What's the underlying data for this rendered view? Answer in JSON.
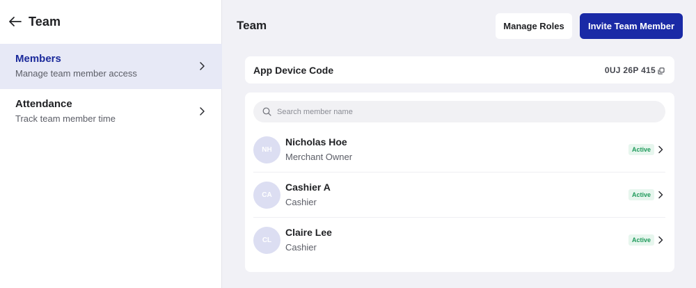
{
  "sidebar": {
    "title": "Team",
    "items": [
      {
        "title": "Members",
        "subtitle": "Manage team member access"
      },
      {
        "title": "Attendance",
        "subtitle": "Track team member time"
      }
    ]
  },
  "main": {
    "title": "Team",
    "manage_roles_label": "Manage Roles",
    "invite_label": "Invite Team Member"
  },
  "device_code": {
    "label": "App Device Code",
    "value": "0UJ 26P 415"
  },
  "search": {
    "placeholder": "Search member name"
  },
  "members": [
    {
      "initials": "NH",
      "name": "Nicholas Hoe",
      "role": "Merchant Owner",
      "status": "Active"
    },
    {
      "initials": "CA",
      "name": "Cashier A",
      "role": "Cashier",
      "status": "Active"
    },
    {
      "initials": "CL",
      "name": "Claire Lee",
      "role": "Cashier",
      "status": "Active"
    }
  ],
  "colors": {
    "primary": "#1a2aa6",
    "active_nav_bg": "#e7e9f6",
    "status_active_text": "#1e9a5a",
    "status_active_bg": "#e7f6ee",
    "avatar_bg": "#dcdef2"
  },
  "icons": [
    "arrow-left-icon",
    "chevron-right-icon",
    "copy-icon",
    "search-icon"
  ]
}
